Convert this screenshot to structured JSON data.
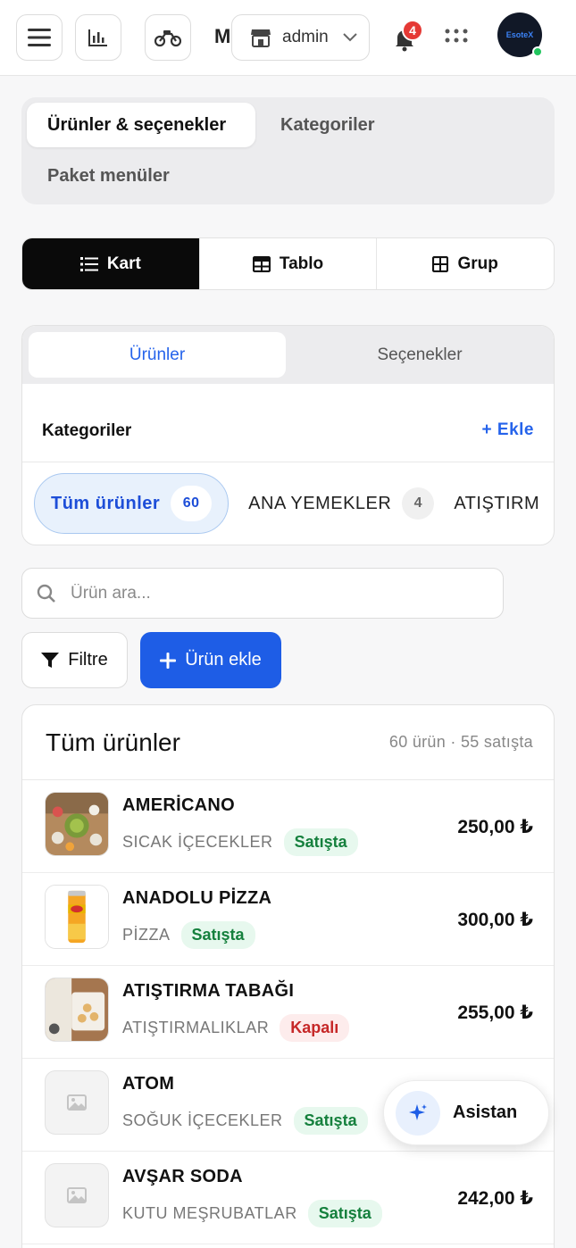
{
  "header": {
    "brand_letter": "M",
    "store_label": "admin",
    "notification_count": "4",
    "avatar_text": "EsoteX",
    "icons": [
      "menu-icon",
      "chart-icon",
      "motorbike-icon",
      "store-icon",
      "chevron-down-icon",
      "bell-icon",
      "apps-grid-icon"
    ]
  },
  "main_tabs": {
    "products": "Ürünler & seçenekler",
    "categories": "Kategoriler",
    "bundles": "Paket menüler"
  },
  "view_switch": {
    "card": "Kart",
    "table": "Tablo",
    "group": "Grup"
  },
  "sub_tabs": {
    "products": "Ürünler",
    "options": "Seçenekler"
  },
  "categories": {
    "title": "Kategoriler",
    "add_label": "+ Ekle",
    "chips": [
      {
        "label": "Tüm ürünler",
        "count": "60"
      },
      {
        "label": "ANA YEMEKLER",
        "count": "4"
      },
      {
        "label": "ATIŞTIRM",
        "count": ""
      }
    ]
  },
  "search": {
    "placeholder": "Ürün ara..."
  },
  "actions": {
    "filter": "Filtre",
    "add_product": "Ürün ekle"
  },
  "list": {
    "title": "Tüm ürünler",
    "meta": "60 ürün · 55 satışta",
    "items": [
      {
        "name": "AMERİCANO",
        "category": "SICAK İÇECEKLER",
        "status": "Satışta",
        "price": "250,00 ₺"
      },
      {
        "name": "ANADOLU PİZZA",
        "category": "PİZZA",
        "status": "Satışta",
        "price": "300,00 ₺"
      },
      {
        "name": "ATIŞTIRMA TABAĞI",
        "category": "ATIŞTIRMALIKLAR",
        "status": "Kapalı",
        "price": "255,00 ₺"
      },
      {
        "name": "ATOM",
        "category": "SOĞUK İÇECEKLER",
        "status": "Satışta",
        "price": ""
      },
      {
        "name": "AVŞAR SODA",
        "category": "KUTU MEŞRUBATLAR",
        "status": "Satışta",
        "price": "242,00 ₺"
      }
    ]
  },
  "assistant": {
    "label": "Asistan"
  },
  "colors": {
    "accent": "#1e5de6",
    "on_sale": "#15803d",
    "closed": "#c62828"
  }
}
